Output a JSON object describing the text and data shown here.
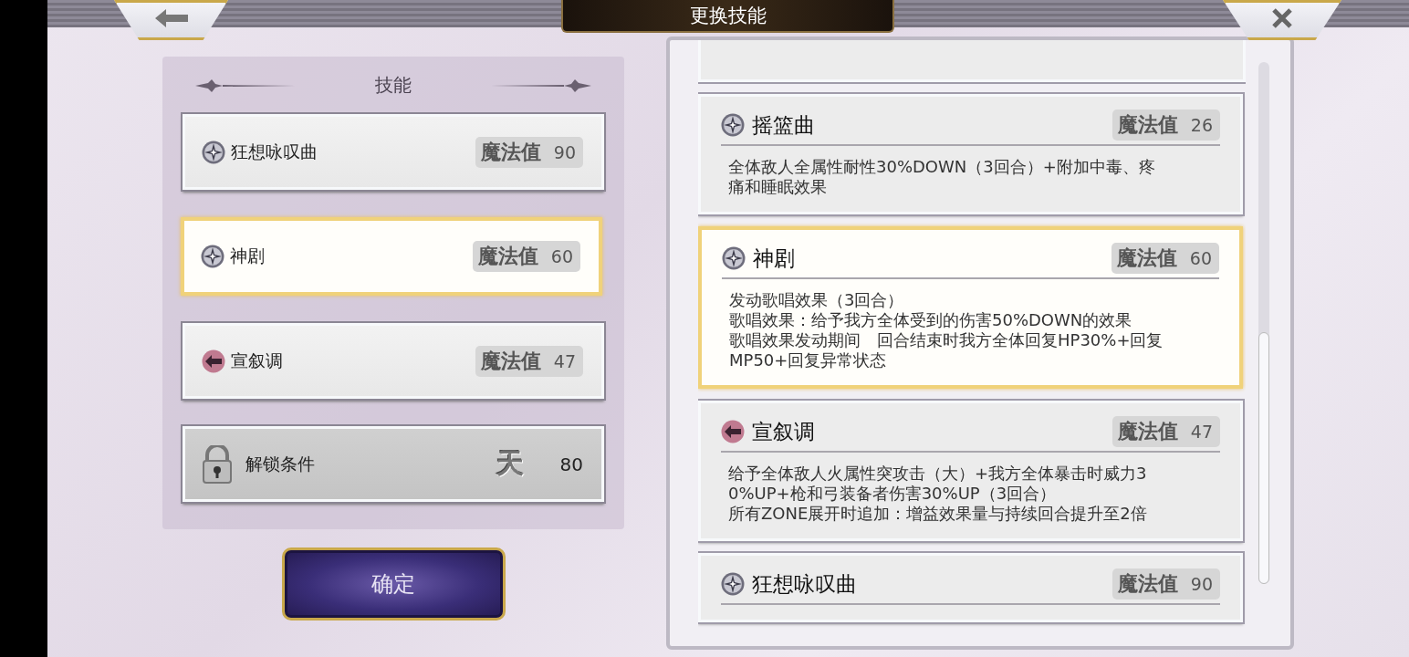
{
  "window": {
    "title": "更换技能"
  },
  "skill_panel": {
    "title": "技能",
    "skills": [
      {
        "kind": "star",
        "name": "狂想咏叹曲",
        "mp_label": "魔法值",
        "mp": "90",
        "selected": false
      },
      {
        "kind": "star",
        "name": "神剧",
        "mp_label": "魔法值",
        "mp": "60",
        "selected": true
      },
      {
        "kind": "arrow",
        "name": "宣叙调",
        "mp_label": "魔法值",
        "mp": "47",
        "selected": false
      },
      {
        "kind": "locked",
        "name": "解锁条件",
        "rank": "天",
        "mp": "80",
        "selected": false
      }
    ]
  },
  "confirm_button": "确定",
  "skill_details": [
    {
      "kind": "star",
      "name": "摇篮曲",
      "mp_label": "魔法值",
      "mp": "26",
      "selected": false,
      "description_lines": [
        "全体敌人全属性耐性30%DOWN（3回合）+附加中毒、疼痛和睡眠效果"
      ]
    },
    {
      "kind": "star",
      "name": "神剧",
      "mp_label": "魔法值",
      "mp": "60",
      "selected": true,
      "description_lines": [
        "发动歌唱效果（3回合）",
        "歌唱效果：给予我方全体受到的伤害50%DOWN的效果",
        "歌唱效果发动期间　回合结束时我方全体回复HP30%+回复MP50+回复异常状态"
      ]
    },
    {
      "kind": "arrow",
      "name": "宣叙调",
      "mp_label": "魔法值",
      "mp": "47",
      "selected": false,
      "description_lines": [
        "给予全体敌人火属性突攻击（大）+我方全体暴击时威力30%UP+枪和弓装备者伤害30%UP（3回合）",
        "所有ZONE展开时追加：增益效果量与持续回合提升至2倍"
      ]
    },
    {
      "kind": "star",
      "name": "狂想咏叹曲",
      "mp_label": "魔法值",
      "mp": "90",
      "selected": false
    }
  ]
}
